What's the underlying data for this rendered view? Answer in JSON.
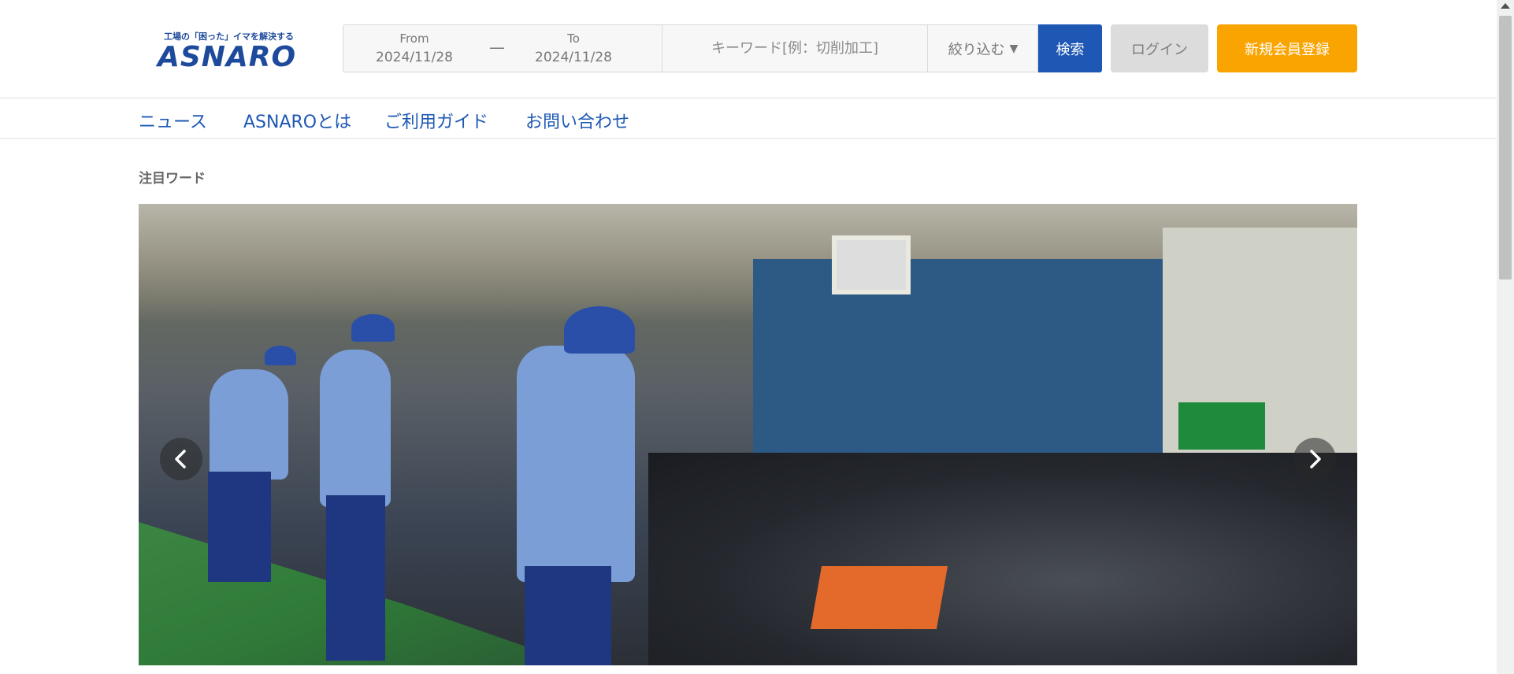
{
  "header": {
    "logo_tagline": "工場の「困った」イマを解決する",
    "logo_text": "ASNARO",
    "search": {
      "from_label": "From",
      "from_value": "2024/11/28",
      "dash": "—",
      "to_label": "To",
      "to_value": "2024/11/28",
      "keyword_placeholder": "キーワード[例：切削加工]",
      "filter_label": "絞り込む",
      "filter_icon": "caret-down-icon",
      "search_button": "検索"
    },
    "login_button": "ログイン",
    "register_button": "新規会員登録"
  },
  "nav": {
    "items": [
      {
        "label": "ニュース"
      },
      {
        "label": "ASNAROとは"
      },
      {
        "label": "ご利用ガイド"
      },
      {
        "label": "お問い合わせ"
      }
    ]
  },
  "featured": {
    "title": "注目ワード",
    "carousel": {
      "prev_icon": "chevron-left-icon",
      "next_icon": "chevron-right-icon"
    }
  },
  "colors": {
    "brand_blue": "#1e58b4",
    "register_orange": "#f9a400",
    "login_gray": "#dcdcdc"
  }
}
